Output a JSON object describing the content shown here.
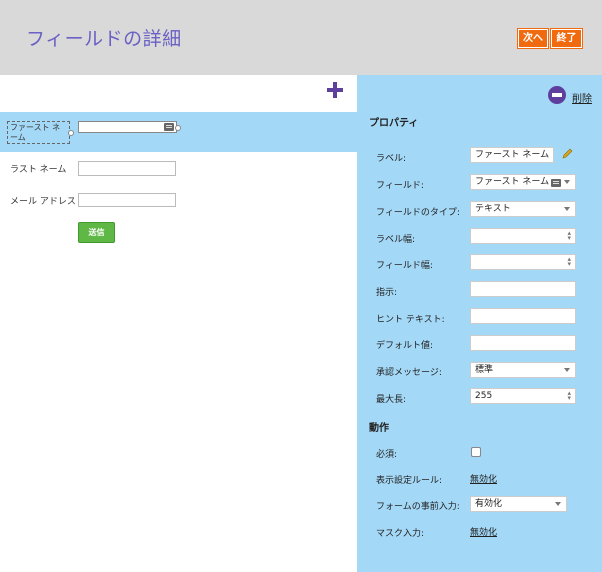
{
  "header": {
    "title": "フィールドの詳細",
    "next_label": "次へ",
    "finish_label": "終了"
  },
  "form": {
    "fields": [
      {
        "label": "ファースト ネーム"
      },
      {
        "label": "ラスト ネーム"
      },
      {
        "label": "メール アドレス"
      }
    ],
    "submit_label": "送信"
  },
  "panel": {
    "delete_label": "削除",
    "properties_heading": "プロパティ",
    "properties": [
      {
        "label": "ラベル:",
        "value": "ファースト ネーム"
      },
      {
        "label": "フィールド:",
        "value": "ファースト ネーム"
      },
      {
        "label": "フィールドのタイプ:",
        "value": "テキスト"
      },
      {
        "label": "ラベル幅:",
        "value": ""
      },
      {
        "label": "フィールド幅:",
        "value": ""
      },
      {
        "label": "指示:",
        "value": ""
      },
      {
        "label": "ヒント テキスト:",
        "value": ""
      },
      {
        "label": "デフォルト値:",
        "value": ""
      },
      {
        "label": "承認メッセージ:",
        "value": "標準"
      },
      {
        "label": "最大長:",
        "value": "255"
      }
    ],
    "actions_heading": "動作",
    "actions": [
      {
        "label": "必須:",
        "value": ""
      },
      {
        "label": "表示設定ルール:",
        "value": "無効化"
      },
      {
        "label": "フォームの事前入力:",
        "value": "有効化"
      },
      {
        "label": "マスク入力:",
        "value": "無効化"
      }
    ]
  },
  "colors": {
    "header_bg": "#d9d9d9",
    "title": "#6a61c4",
    "accent_button": "#f06a0f",
    "panel_bg": "#a4d8f7",
    "submit": "#5fb845",
    "icon_purple": "#5e3f9e"
  },
  "icons": [
    "plus-icon",
    "delete-icon",
    "pencil-icon",
    "field-card-icon",
    "chevron-down-icon",
    "spinner-icon"
  ]
}
